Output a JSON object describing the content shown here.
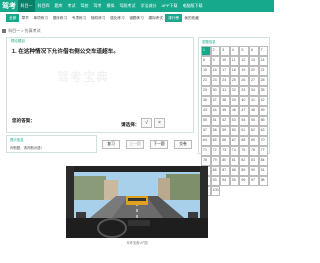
{
  "nav": {
    "brand": "驾考",
    "items": [
      "科目一",
      "科目四",
      "题库",
      "考试",
      "驾校",
      "驾考",
      "模拟",
      "驾照考试",
      "学法减分",
      "APP下载",
      "电脑版下载"
    ],
    "active_index": 0
  },
  "subnav": {
    "items": [
      "全部",
      "章节",
      "单项练习",
      "顺序练习",
      "专项练习",
      "随机练习",
      "强化练习",
      "错题练习",
      "模拟考试",
      "排行榜",
      "我的收藏"
    ],
    "highlight_index": 9
  },
  "breadcrumb": "科目一 > 仿真考试",
  "question_panel": {
    "title": "理论题目",
    "question": "1. 在这种情况下允许借右侧公交车道超车。",
    "my_answer_label": "您的答案：",
    "choose_label": "请选择：",
    "options": [
      "√",
      "×"
    ],
    "watermark": "驾考宝典"
  },
  "explain_panel": {
    "title": "提示信息",
    "text": "判断题，请判断对错！"
  },
  "buttons": {
    "review": "复习",
    "prev": "上一题",
    "next": "下一题",
    "submit": "交卷"
  },
  "grid_panel": {
    "title": "答题信息",
    "numbers": [
      "1",
      "2",
      "3",
      "4",
      "5",
      "6",
      "7",
      "8",
      "9",
      "10",
      "11",
      "12",
      "13",
      "14",
      "15",
      "16",
      "17",
      "18",
      "19",
      "20",
      "21",
      "22",
      "23",
      "24",
      "25",
      "26",
      "27",
      "28",
      "29",
      "30",
      "31",
      "32",
      "33",
      "34",
      "35",
      "36",
      "37",
      "38",
      "39",
      "40",
      "41",
      "42",
      "43",
      "44",
      "45",
      "46",
      "47",
      "48",
      "49",
      "50",
      "51",
      "52",
      "53",
      "54",
      "55",
      "56",
      "57",
      "58",
      "59",
      "60",
      "61",
      "62",
      "63",
      "64",
      "65",
      "66",
      "67",
      "68",
      "69",
      "70",
      "71",
      "72",
      "73",
      "74",
      "75",
      "76",
      "77",
      "78",
      "79",
      "80",
      "81",
      "82",
      "83",
      "84",
      "85",
      "86",
      "87",
      "88",
      "89",
      "90",
      "91",
      "92",
      "93",
      "94",
      "95",
      "96",
      "97",
      "98",
      "99",
      "100"
    ],
    "current": 1
  },
  "image_caption": "驾考宝典VIP图",
  "colors": {
    "accent": "#16a98c",
    "accent_dark": "#0d7f69"
  }
}
